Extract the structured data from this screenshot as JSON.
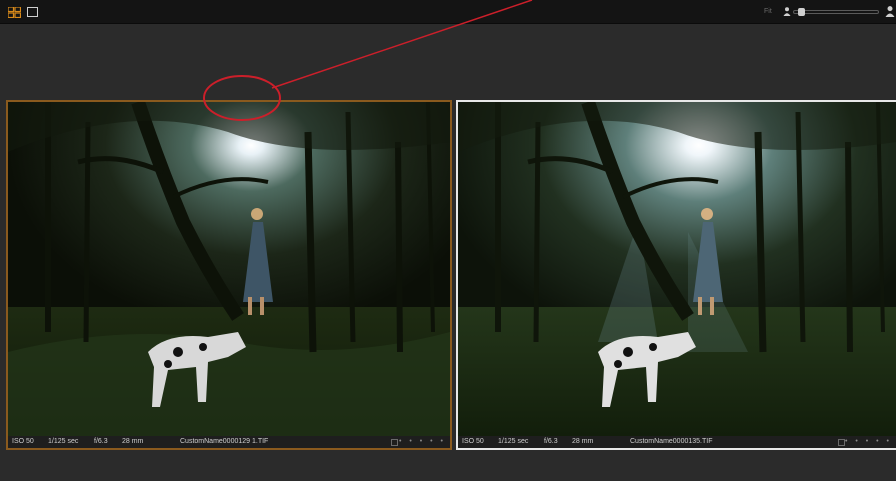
{
  "topbar": {
    "fit_label": "Fit",
    "icons": [
      "grid-view-icon",
      "single-view-icon",
      "person-small-icon",
      "zoom-slider",
      "person-large-icon"
    ],
    "zoom_slider_value": 0.05
  },
  "colors": {
    "background": "#2b2b2b",
    "topbar": "#141414",
    "selected_border_left": "#8a5a1e",
    "selected_border_right": "#e8e8e8",
    "grid_icon": "#d88a1a",
    "annotation": "#cc1f2a"
  },
  "photos": [
    {
      "iso": "ISO 50",
      "shutter": "1/125 sec",
      "aperture": "f/6.3",
      "focal": "28 mm",
      "filename": "CustomName0000129 1.TIF",
      "rating_dots": "• • • • •"
    },
    {
      "iso": "ISO 50",
      "shutter": "1/125 sec",
      "aperture": "f/6.3",
      "focal": "28 mm",
      "filename": "CustomName0000135.TIF",
      "rating_dots": "• • • • •"
    }
  ]
}
